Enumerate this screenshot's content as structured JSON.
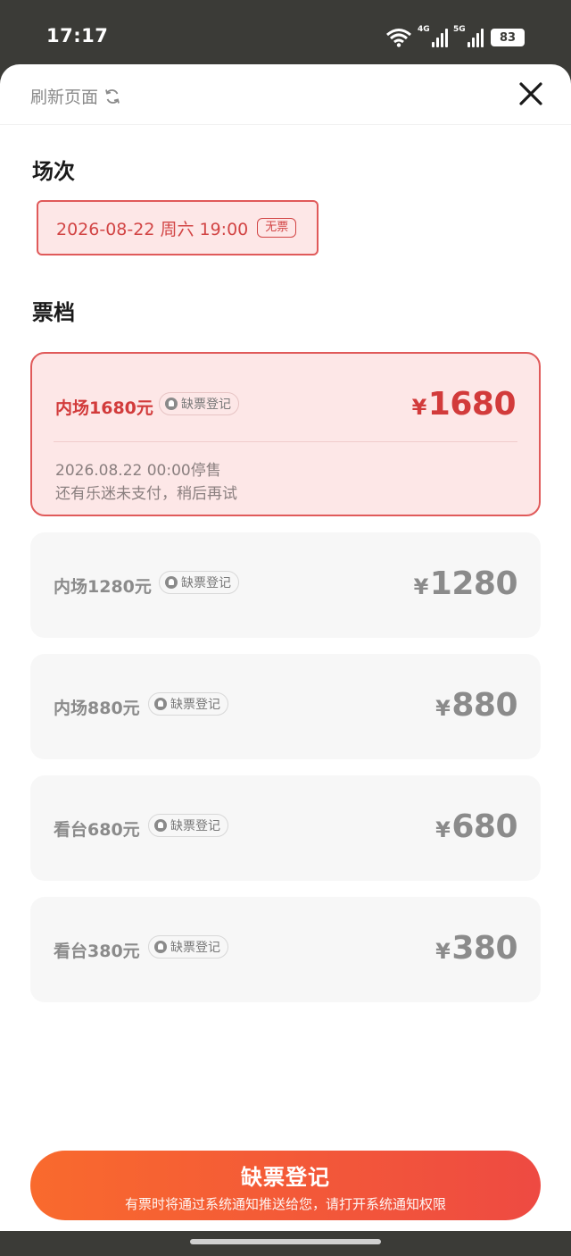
{
  "status_bar": {
    "time": "17:17",
    "network_1": "4G",
    "network_2": "5G",
    "battery": "83"
  },
  "header": {
    "refresh_label": "刷新页面",
    "refresh_icon": "refresh-icon",
    "close_icon": "close-icon"
  },
  "session": {
    "title": "场次",
    "datetime": "2026-08-22 周六 19:00",
    "status": "无票"
  },
  "tickets": {
    "title": "票档",
    "items": [
      {
        "name": "内场1680元",
        "badge": "缺票登记",
        "yen": "¥",
        "price": "1680",
        "sale_time": "2026.08.22 00:00停售",
        "note": "还有乐迷未支付，稍后再试"
      },
      {
        "name": "内场1280元",
        "badge": "缺票登记",
        "yen": "¥",
        "price": "1280"
      },
      {
        "name": "内场880元",
        "badge": "缺票登记",
        "yen": "¥",
        "price": "880"
      },
      {
        "name": "看台680元",
        "badge": "缺票登记",
        "yen": "¥",
        "price": "680"
      },
      {
        "name": "看台380元",
        "badge": "缺票登记",
        "yen": "¥",
        "price": "380"
      }
    ]
  },
  "cta": {
    "label": "缺票登记",
    "sub_label": "有票时将通过系统通知推送给您，请打开系统通知权限"
  },
  "colors": {
    "accent": "#d23b3b",
    "selected_bg": "#fde7e7",
    "cta_start": "#f96a2d",
    "cta_end": "#ee4a42"
  }
}
